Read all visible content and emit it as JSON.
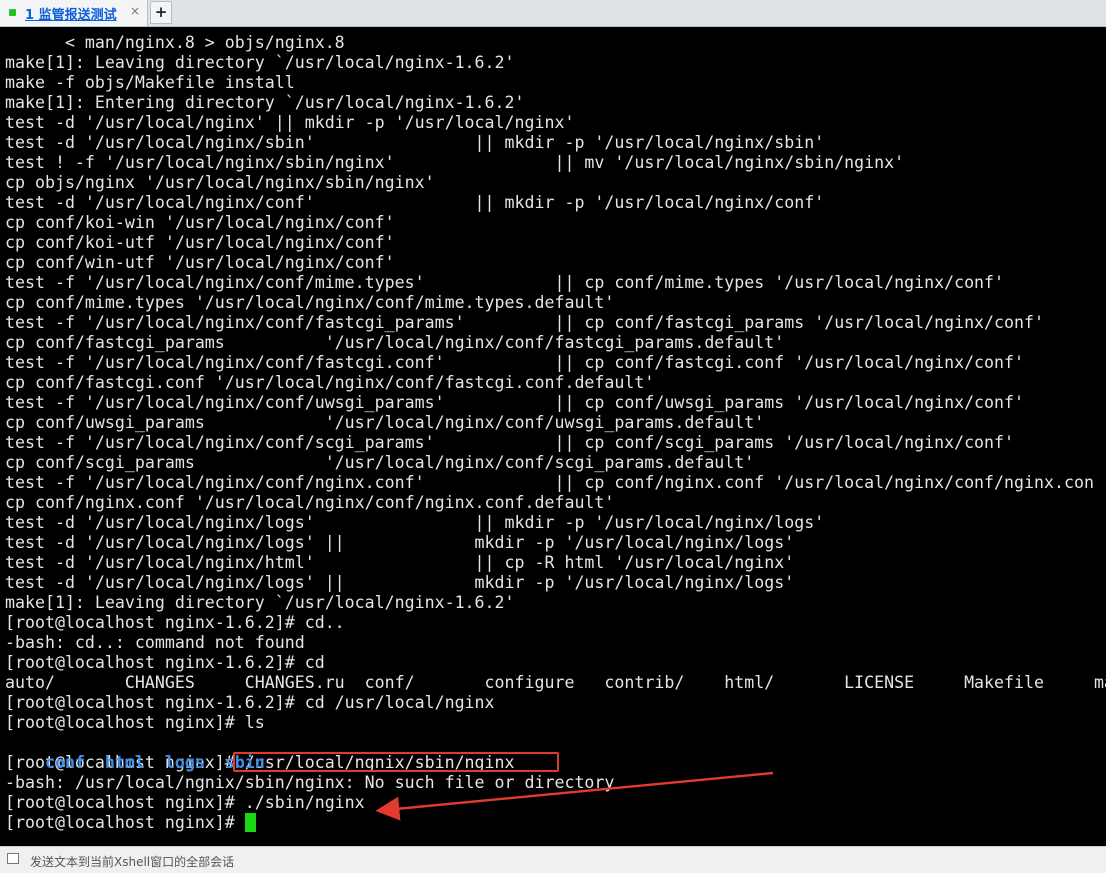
{
  "tab": {
    "label": "1 监管报送测试",
    "close": "×",
    "add": "+"
  },
  "terminal": {
    "lines": [
      "      < man/nginx.8 > objs/nginx.8",
      "make[1]: Leaving directory `/usr/local/nginx-1.6.2'",
      "make -f objs/Makefile install",
      "make[1]: Entering directory `/usr/local/nginx-1.6.2'",
      "test -d '/usr/local/nginx' || mkdir -p '/usr/local/nginx'",
      "test -d '/usr/local/nginx/sbin'                || mkdir -p '/usr/local/nginx/sbin'",
      "test ! -f '/usr/local/nginx/sbin/nginx'                || mv '/usr/local/nginx/sbin/nginx'",
      "cp objs/nginx '/usr/local/nginx/sbin/nginx'",
      "test -d '/usr/local/nginx/conf'                || mkdir -p '/usr/local/nginx/conf'",
      "cp conf/koi-win '/usr/local/nginx/conf'",
      "cp conf/koi-utf '/usr/local/nginx/conf'",
      "cp conf/win-utf '/usr/local/nginx/conf'",
      "test -f '/usr/local/nginx/conf/mime.types'             || cp conf/mime.types '/usr/local/nginx/conf'",
      "cp conf/mime.types '/usr/local/nginx/conf/mime.types.default'",
      "test -f '/usr/local/nginx/conf/fastcgi_params'         || cp conf/fastcgi_params '/usr/local/nginx/conf'",
      "cp conf/fastcgi_params          '/usr/local/nginx/conf/fastcgi_params.default'",
      "test -f '/usr/local/nginx/conf/fastcgi.conf'           || cp conf/fastcgi.conf '/usr/local/nginx/conf'",
      "cp conf/fastcgi.conf '/usr/local/nginx/conf/fastcgi.conf.default'",
      "test -f '/usr/local/nginx/conf/uwsgi_params'           || cp conf/uwsgi_params '/usr/local/nginx/conf'",
      "cp conf/uwsgi_params            '/usr/local/nginx/conf/uwsgi_params.default'",
      "test -f '/usr/local/nginx/conf/scgi_params'            || cp conf/scgi_params '/usr/local/nginx/conf'",
      "cp conf/scgi_params             '/usr/local/nginx/conf/scgi_params.default'",
      "test -f '/usr/local/nginx/conf/nginx.conf'             || cp conf/nginx.conf '/usr/local/nginx/conf/nginx.con",
      "cp conf/nginx.conf '/usr/local/nginx/conf/nginx.conf.default'",
      "test -d '/usr/local/nginx/logs'                || mkdir -p '/usr/local/nginx/logs'",
      "test -d '/usr/local/nginx/logs' ||             mkdir -p '/usr/local/nginx/logs'",
      "test -d '/usr/local/nginx/html'                || cp -R html '/usr/local/nginx'",
      "test -d '/usr/local/nginx/logs' ||             mkdir -p '/usr/local/nginx/logs'",
      "make[1]: Leaving directory `/usr/local/nginx-1.6.2'",
      "[root@localhost nginx-1.6.2]# cd..",
      "-bash: cd..: command not found",
      "[root@localhost nginx-1.6.2]# cd",
      "auto/       CHANGES     CHANGES.ru  conf/       configure   contrib/    html/       LICENSE     Makefile     ma",
      "[root@localhost nginx-1.6.2]# cd /usr/local/nginx",
      "[root@localhost nginx]# ls",
      "",
      "[root@localhost nginx]# /usr/local/ngnix/sbin/nginx",
      "-bash: /usr/local/ngnix/sbin/nginx: No such file or directory",
      "[root@localhost nginx]# ./sbin/nginx",
      "[root@localhost nginx]# "
    ],
    "ls_output": [
      "conf",
      "html",
      "logs",
      "sbin"
    ]
  },
  "colors": {
    "terminal_bg": "#000000",
    "text": "#e5e5e5",
    "dir": "#3f8fe8",
    "cursor": "#18d818",
    "annotation": "#e23a2e"
  },
  "statusbar": {
    "text": "发送文本到当前Xshell窗口的全部会话"
  }
}
